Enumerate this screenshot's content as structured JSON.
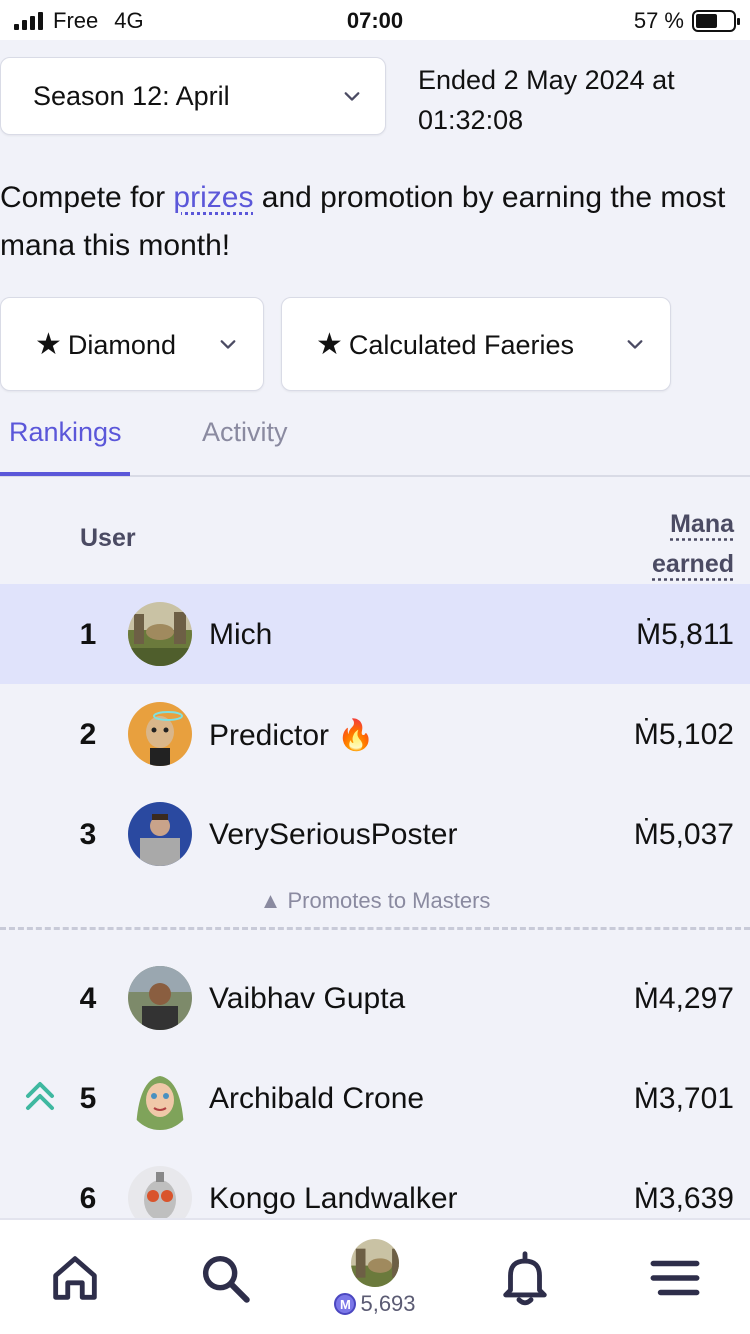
{
  "status_bar": {
    "carrier": "Free",
    "network": "4G",
    "time": "07:00",
    "battery": "57 %",
    "battery_level": 0.57
  },
  "season_select": {
    "value": "Season 12: April"
  },
  "ended_text": "Ended 2 May 2024 at 01:32:08",
  "intro": {
    "before": "Compete for ",
    "link": "prizes",
    "after": " and promotion by earning the most mana this month!"
  },
  "division_select": {
    "value": "Diamond",
    "star": "★"
  },
  "cohort_select": {
    "value": "Calculated Faeries",
    "star": "★"
  },
  "tabs": [
    {
      "label": "Rankings",
      "active": true
    },
    {
      "label": "Activity",
      "active": false
    }
  ],
  "table": {
    "header_user": "User",
    "header_mana": "Mana earned",
    "rows": [
      {
        "rank": "1",
        "name": "Mich",
        "mana": "Ṁ5,811"
      },
      {
        "rank": "2",
        "name": "Predictor",
        "badge": "🔥",
        "mana": "Ṁ5,102"
      },
      {
        "rank": "3",
        "name": "VerySeriousPoster",
        "mana": "Ṁ5,037"
      },
      {
        "rank": "4",
        "name": "Vaibhav Gupta",
        "mana": "Ṁ4,297"
      },
      {
        "rank": "5",
        "name": "Archibald Crone",
        "mana": "Ṁ3,701"
      },
      {
        "rank": "6",
        "name": "Kongo Landwalker",
        "mana": "Ṁ3,639"
      }
    ],
    "promotes_label": "▲ Promotes to Masters"
  },
  "bottom_nav": {
    "balance": "5,693",
    "coin_symbol": "M"
  },
  "colors": {
    "accent": "#5b57d9",
    "highlight_row": "#e0e3fb",
    "promo_arrow": "#3fb8a0",
    "background": "#f1f2f9"
  },
  "icons": [
    "home-icon",
    "search-icon",
    "bell-icon",
    "menu-icon",
    "chevron-down-icon",
    "double-chevron-up-icon",
    "mana-coin-icon"
  ]
}
